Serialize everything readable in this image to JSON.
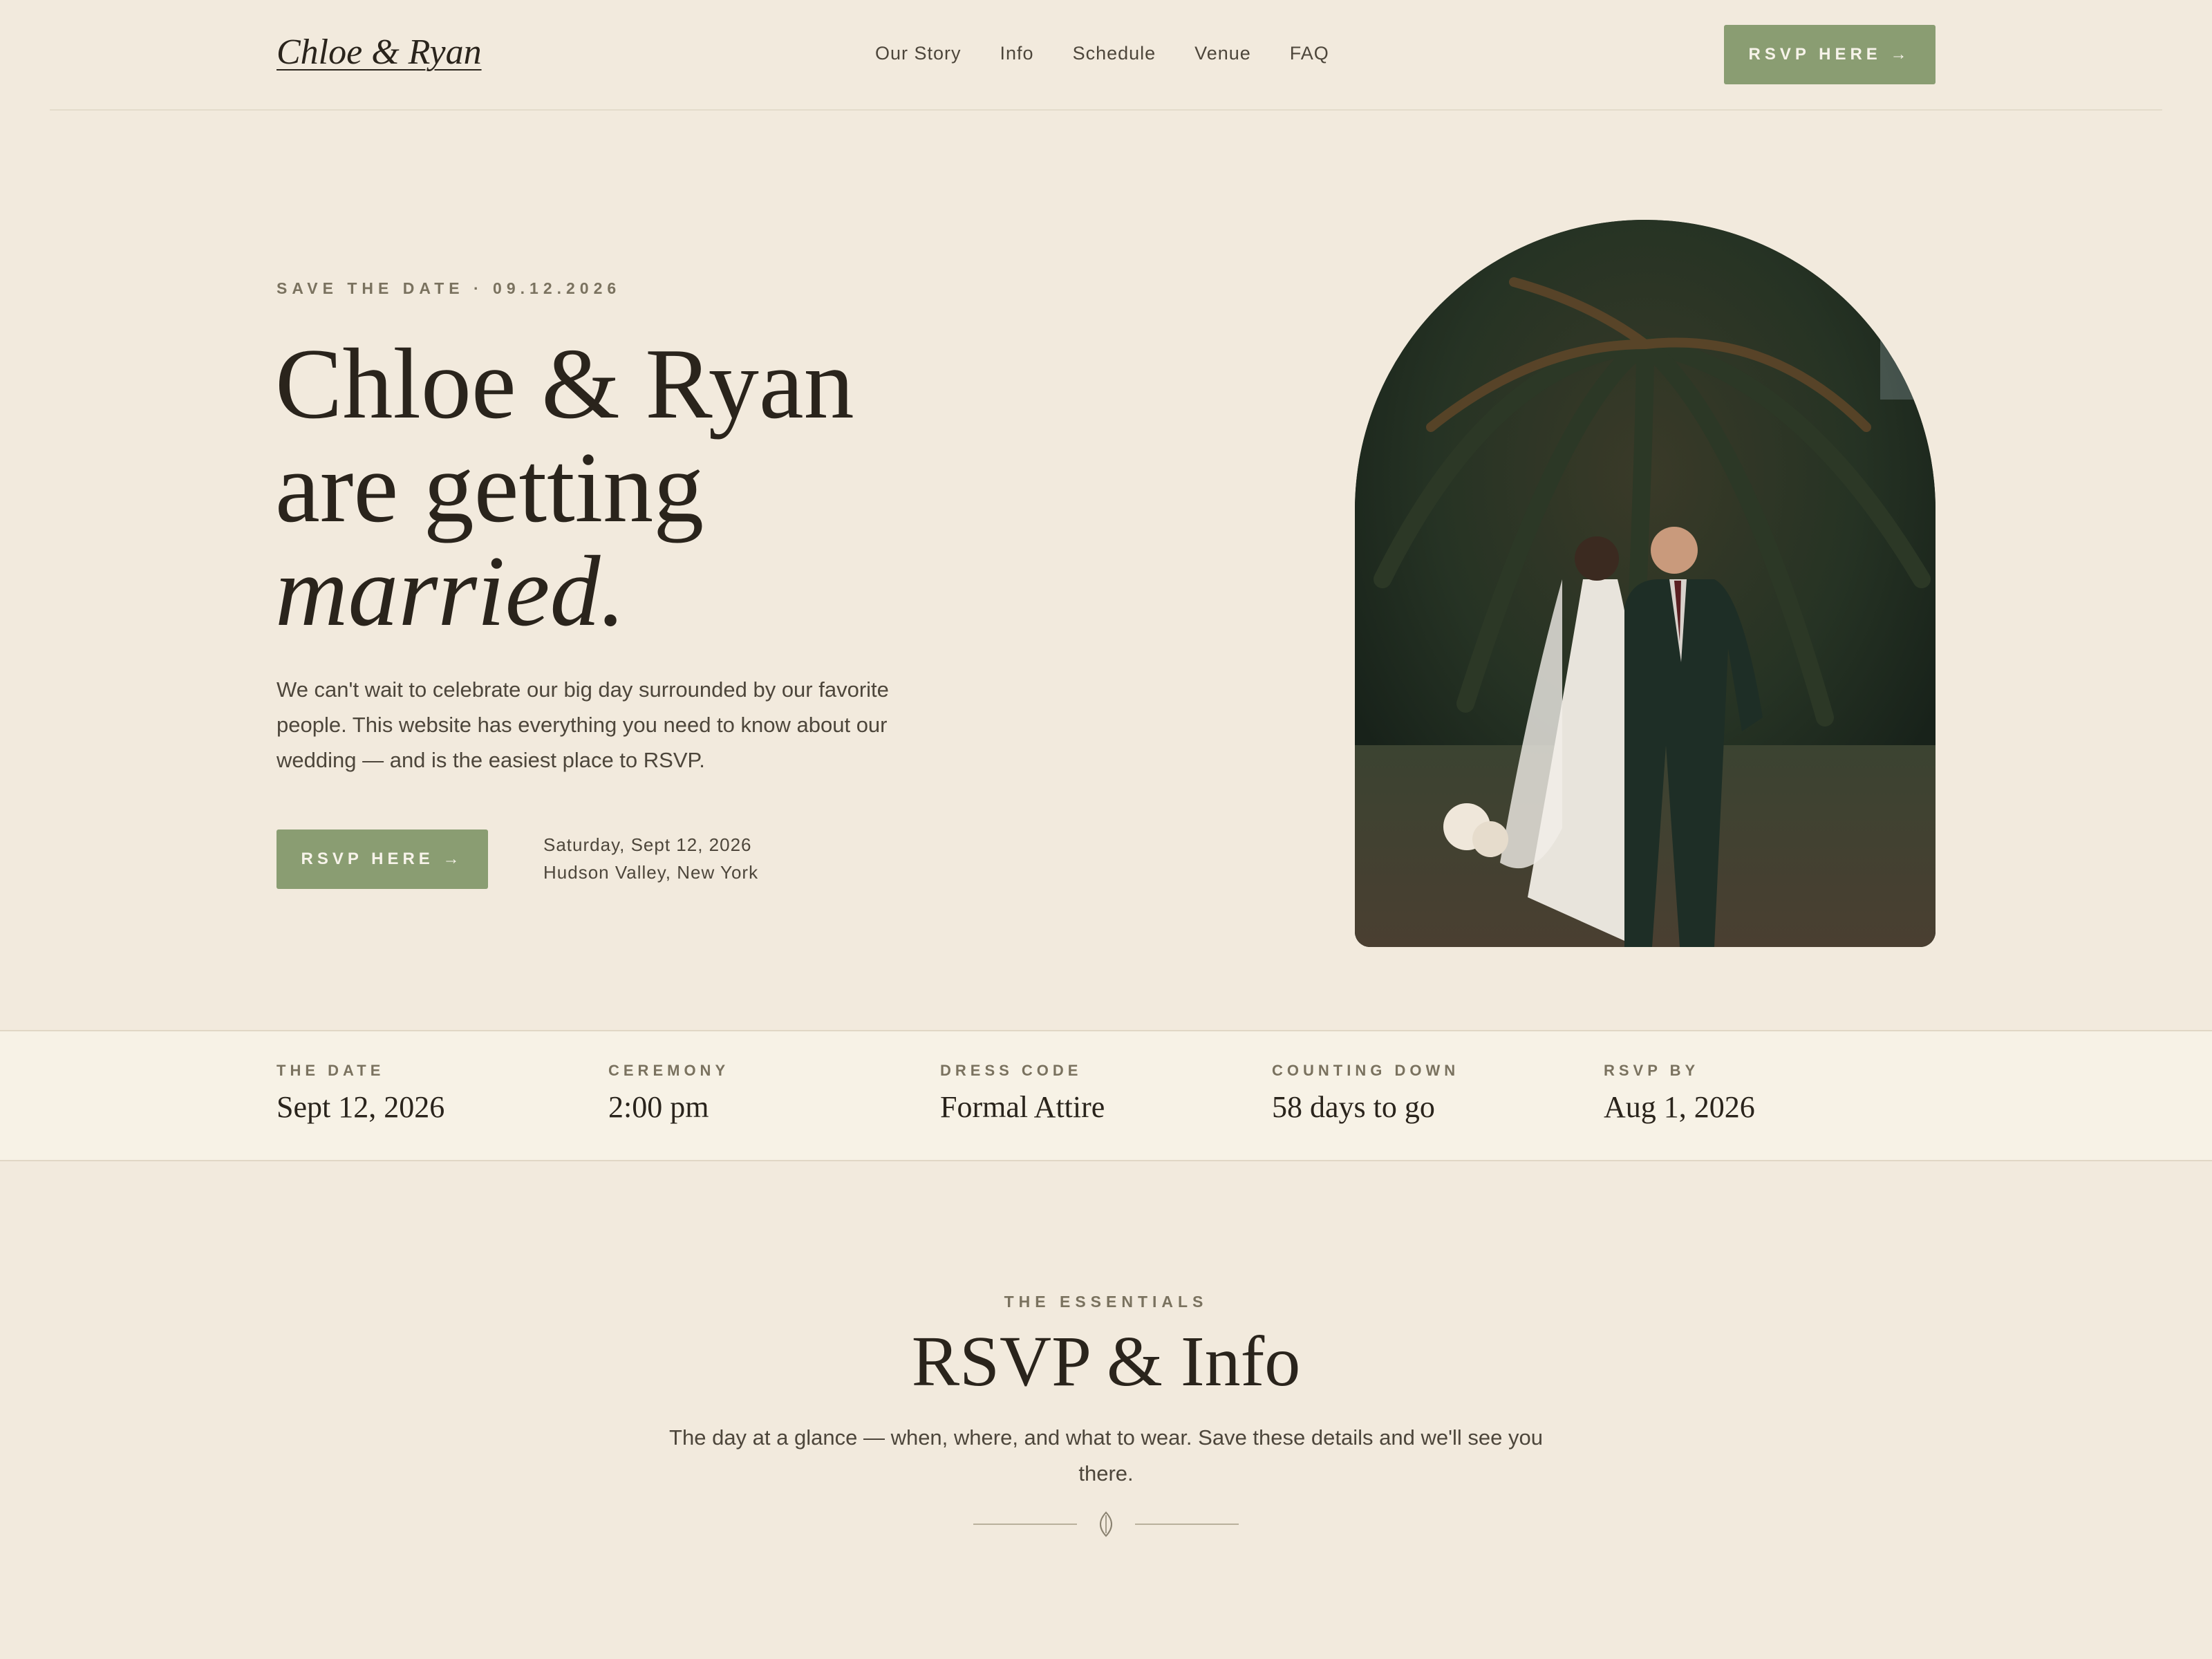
{
  "nav": {
    "logo": "Chloe & Ryan",
    "links": [
      "Our Story",
      "Info",
      "Schedule",
      "Venue",
      "FAQ"
    ],
    "rsvp_label": "RSVP HERE →"
  },
  "hero": {
    "eyebrow": "SAVE THE DATE · 09.12.2026",
    "headline_line1": "Chloe & Ryan",
    "headline_line2": "are getting",
    "headline_line3": "married.",
    "intro": "We can't wait to celebrate our big day surrounded by our favorite people. This website has everything you need to know about our wedding — and is the easiest place to RSVP.",
    "rsvp_label": "RSVP HERE →",
    "date_line": "Saturday, Sept 12, 2026",
    "location_line": "Hudson Valley, New York"
  },
  "stats": [
    {
      "label": "THE DATE",
      "value": "Sept 12, 2026"
    },
    {
      "label": "CEREMONY",
      "value": "2:00 pm"
    },
    {
      "label": "DRESS CODE",
      "value": "Formal Attire"
    },
    {
      "label": "COUNTING DOWN",
      "value": "58 days to go"
    },
    {
      "label": "RSVP BY",
      "value": "Aug 1, 2026"
    }
  ],
  "essentials": {
    "eyebrow": "THE ESSENTIALS",
    "title": "RSVP & Info",
    "subtitle": "The day at a glance — when, where, and what to wear. Save these details and we'll see you there."
  },
  "colors": {
    "background": "#f2eadd",
    "strip_background": "#f7f2e6",
    "accent_green": "#8a9d72",
    "text_dark": "#2a241c",
    "text_muted": "#7a725f"
  },
  "icons": {
    "divider": "leaf-icon"
  }
}
